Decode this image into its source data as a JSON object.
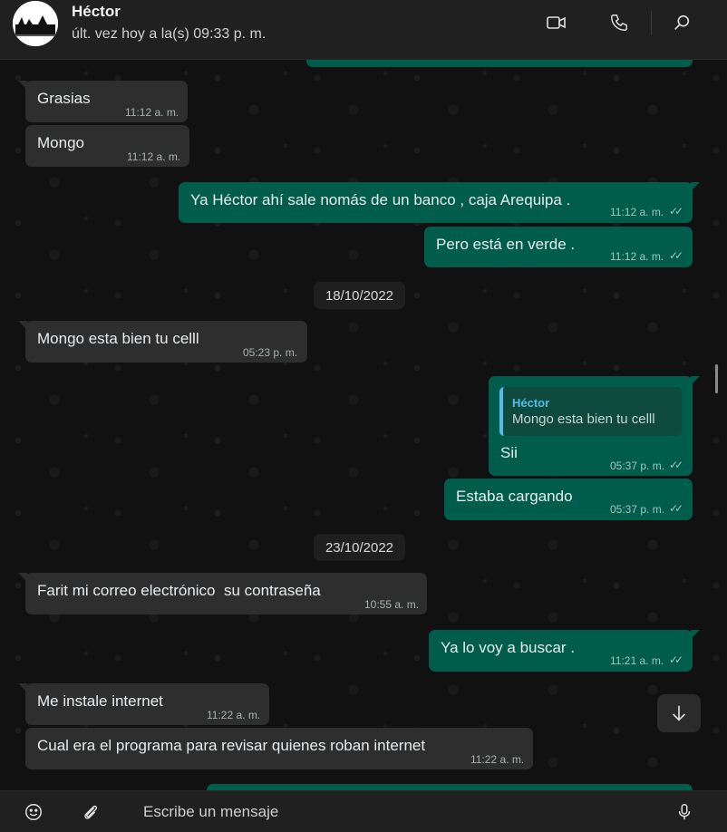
{
  "header": {
    "contact_name": "Héctor",
    "last_seen": "últ. vez hoy a la(s) 09:33 p. m."
  },
  "messages": [
    {
      "direction": "in",
      "text": "Grasias",
      "time": "11:12 a. m."
    },
    {
      "direction": "in",
      "text": "Mongo",
      "time": "11:12 a. m."
    },
    {
      "direction": "out",
      "text": "Ya Héctor ahí sale nomás de un banco , caja Arequipa .",
      "time": "11:12 a. m."
    },
    {
      "direction": "out",
      "text": "Pero está en verde .",
      "time": "11:12 a. m."
    },
    {
      "direction": "in",
      "text": "Mongo esta bien tu celll",
      "time": "05:23 p. m."
    },
    {
      "direction": "out",
      "text": "Sii",
      "time": "05:37 p. m.",
      "quote_name": "Héctor",
      "quote_text": "Mongo esta bien tu celll"
    },
    {
      "direction": "out",
      "text": "Estaba cargando",
      "time": "05:37 p. m."
    },
    {
      "direction": "in",
      "text": "Farit mi correo electrónico  su contraseña",
      "time": "10:55 a. m."
    },
    {
      "direction": "out",
      "text": "Ya lo voy a buscar .",
      "time": "11:21 a. m."
    },
    {
      "direction": "in",
      "text": "Me instale internet",
      "time": "11:22 a. m."
    },
    {
      "direction": "in",
      "text": "Cual era el programa para revisar quienes roban internet",
      "time": "11:22 a. m."
    }
  ],
  "dates": [
    "18/10/2022",
    "23/10/2022"
  ],
  "compose": {
    "placeholder": "Escribe un mensaje"
  },
  "icons": {
    "video": "video-camera-icon",
    "call": "phone-icon",
    "search": "search-icon",
    "emoji": "emoji-icon",
    "attach": "paperclip-icon",
    "mic": "microphone-icon",
    "scroll": "arrow-down-icon"
  },
  "colors": {
    "outgoing_bubble": "#005c4b",
    "incoming_bubble": "#2e2e2e",
    "quote_accent": "#53bdeb",
    "background": "#111111"
  }
}
